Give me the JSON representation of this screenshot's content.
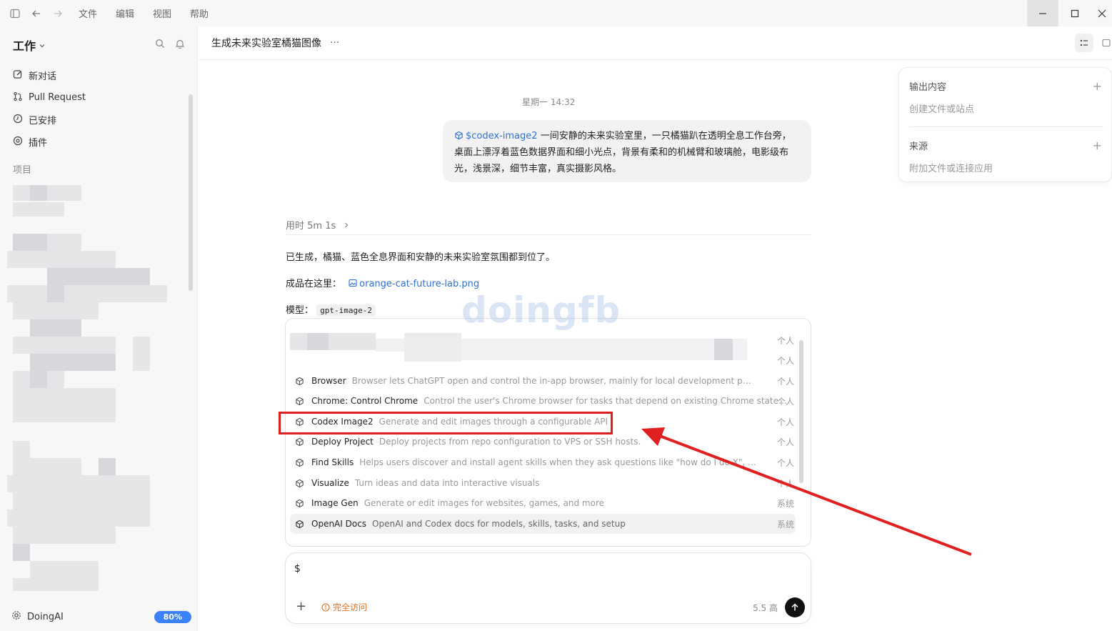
{
  "titlebar": {
    "menu": [
      "文件",
      "编辑",
      "视图",
      "帮助"
    ]
  },
  "sidebar": {
    "workspace": "工作",
    "nav": [
      {
        "label": "新对话",
        "icon": "edit-icon"
      },
      {
        "label": "Pull Request",
        "icon": "git-pull-request-icon"
      },
      {
        "label": "已安排",
        "icon": "clock-icon"
      },
      {
        "label": "插件",
        "icon": "plugin-icon"
      }
    ],
    "section": "项目",
    "footer": {
      "name": "DoingAI",
      "usage": "80%"
    }
  },
  "header": {
    "title": "生成未来实验室橘猫图像",
    "more": "···"
  },
  "chat": {
    "timestamp": "星期一 14:32",
    "user_skill": "$codex-image2",
    "user_message": "一间安静的未来实验室里，一只橘猫趴在透明全息工作台旁，桌面上漂浮着蓝色数据界面和细小光点，背景有柔和的机械臂和玻璃舱，电影级布光，浅景深，细节丰富，真实摄影风格。",
    "took": "用时 5m 1s",
    "answer_line1": "已生成，橘猫、蓝色全息界面和安静的未来实验室氛围都到位了。",
    "answer_line2_prefix": "成品在这里：",
    "answer_file": "orange-cat-future-lab.png",
    "answer_line3_prefix": "模型：",
    "answer_model": "gpt-image-2"
  },
  "panel": {
    "output_title": "输出内容",
    "output_sub": "创建文件或站点",
    "source_title": "来源",
    "source_sub": "附加文件或连接应用"
  },
  "skills": [
    {
      "name": "Browser",
      "desc": "Browser lets ChatGPT open and control the in-app browser, mainly for local development pages an...",
      "tag": "个人"
    },
    {
      "name": "Chrome: Control Chrome",
      "desc": "Control the user's Chrome browser for tasks that depend on existing Chrome state:...",
      "tag": "个人"
    },
    {
      "name": "Codex Image2",
      "desc": "Generate and edit images through a configurable API",
      "tag": "个人"
    },
    {
      "name": "Deploy Project",
      "desc": "Deploy projects from repo configuration to VPS or SSH hosts.",
      "tag": "个人"
    },
    {
      "name": "Find Skills",
      "desc": "Helps users discover and install agent skills when they ask questions like \"how do I do X\", \"find a s...",
      "tag": "个人"
    },
    {
      "name": "Visualize",
      "desc": "Turn ideas and data into interactive visuals",
      "tag": "个人"
    },
    {
      "name": "Image Gen",
      "desc": "Generate or edit images for websites, games, and more",
      "tag": "系统"
    },
    {
      "name": "OpenAI Docs",
      "desc": "OpenAI and Codex docs for models, skills, tasks, and setup",
      "tag": "系统"
    }
  ],
  "skills_hidden_tags": [
    "个人",
    "个人"
  ],
  "composer": {
    "text": "$",
    "access": "完全访问",
    "model": "5.5 高"
  },
  "watermark": "doingfb"
}
